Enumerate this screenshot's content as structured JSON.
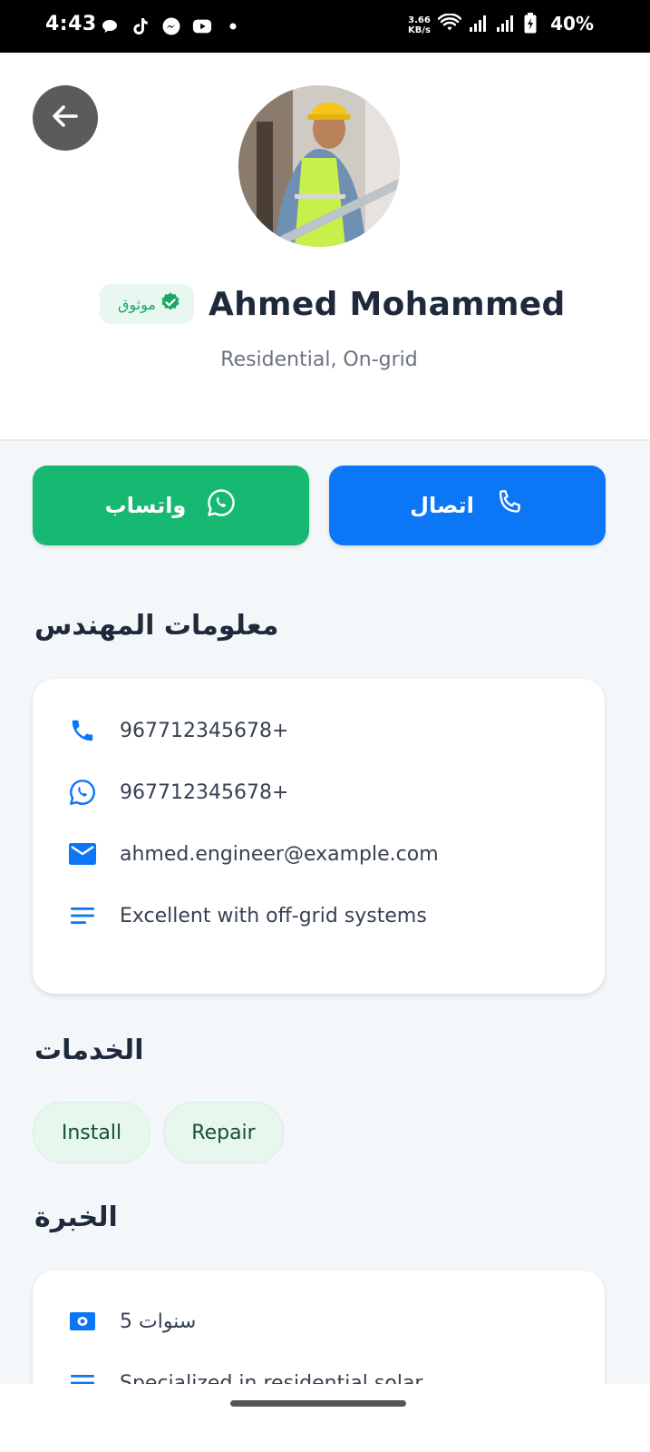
{
  "status_bar": {
    "time": "4:43",
    "net_speed_value": "3.66",
    "net_speed_unit": "KB/s",
    "battery": "40%"
  },
  "header": {
    "name": "Ahmed Mohammed",
    "verified_label": "موثوق",
    "specialty": "Residential, On-grid"
  },
  "actions": {
    "whatsapp_label": "واتساب",
    "call_label": "اتصال"
  },
  "engineer_info": {
    "title": "معلومات المهندس",
    "phone": "967712345678+",
    "whatsapp": "967712345678+",
    "email": "ahmed.engineer@example.com",
    "notes": "Excellent with off-grid systems"
  },
  "services": {
    "title": "الخدمات",
    "items": [
      "Install",
      "Repair"
    ]
  },
  "experience": {
    "title": "الخبرة",
    "years": "5 سنوات",
    "description": "Specialized in residential solar"
  },
  "colors": {
    "primary_blue": "#0b77f7",
    "whatsapp_green": "#16b872",
    "verified_green": "#19a864",
    "background": "#f4f7fa"
  }
}
